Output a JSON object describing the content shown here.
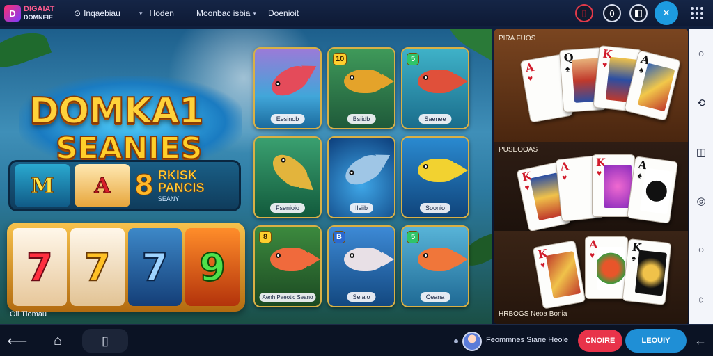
{
  "app": {
    "logo_line1": "DIGAIAT",
    "logo_line2": "DOMNEIE"
  },
  "nav": {
    "item1_icon": "⊙",
    "item1": "Inqaebiau",
    "item2": "Hoden",
    "item3": "Moonbac isbia",
    "item4": "Doenioit"
  },
  "top_icons": {
    "icon1": "▯",
    "icon2": "0",
    "icon3": "◧",
    "icon4": "✕"
  },
  "hero": {
    "title_line1": "DOMKA1",
    "title_line2": "SEANIES"
  },
  "promo": {
    "tile1": "M",
    "tile2": "A",
    "bonus_number": "8",
    "bonus_line1": "RKISK",
    "bonus_line2": "PANCIS",
    "bonus_line3": "SEANY"
  },
  "slot": {
    "reels": [
      "7",
      "7",
      "7",
      "9"
    ],
    "caption": "Oil Tlomau"
  },
  "games": [
    {
      "label": "Eesinob",
      "badge": ""
    },
    {
      "label": "Bsiidb",
      "badge": "10"
    },
    {
      "label": "Saenee",
      "badge": "5"
    },
    {
      "label": "Fsenioio",
      "badge": ""
    },
    {
      "label": "Ilsiib",
      "badge": ""
    },
    {
      "label": "Soonio",
      "badge": ""
    },
    {
      "label": "Aenh Paeotic Seano",
      "badge": "8"
    },
    {
      "label": "Seiaio",
      "badge": "B"
    },
    {
      "label": "Ceana",
      "badge": "5"
    }
  ],
  "card_panel": {
    "section1_title": "PIRA FUOS",
    "section2_title": "PUSEOOAS",
    "section3_title": "HRBOGS Neoa Bonia"
  },
  "rail_icons": [
    "○",
    "⟲",
    "◫",
    "◎",
    "○",
    "☼"
  ],
  "bottom": {
    "user_text": "Feommnes Siarie Heole",
    "btn_red": "CNOIRE",
    "btn_blue": "LEOUIY"
  }
}
